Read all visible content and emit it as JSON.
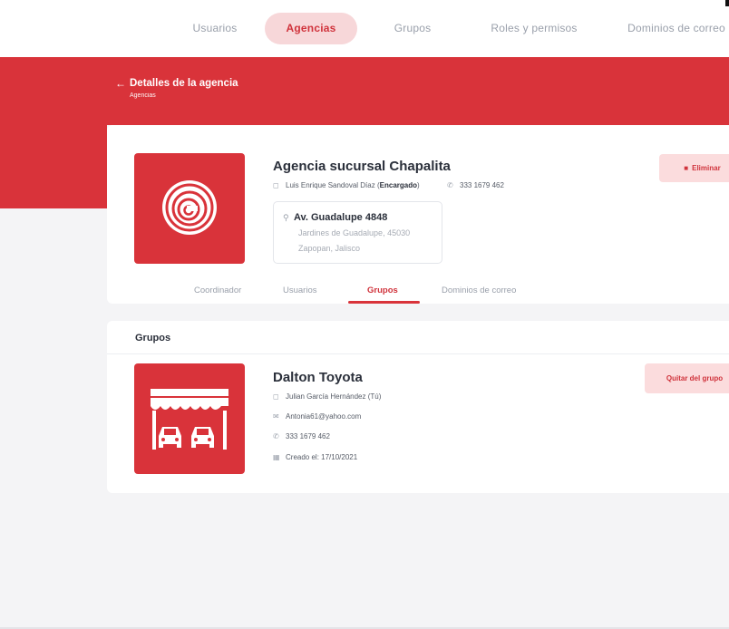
{
  "nav": {
    "tabs": [
      {
        "label": "Usuarios",
        "active": false
      },
      {
        "label": "Agencias",
        "active": true
      },
      {
        "label": "Grupos",
        "active": false
      },
      {
        "label": "Roles y permisos",
        "active": false
      },
      {
        "label": "Dominios de correo",
        "active": false
      }
    ]
  },
  "header": {
    "back_arrow": "←",
    "title": "Detalles de la agencia",
    "breadcrumb": "Agencias"
  },
  "agency": {
    "name": "Agencia sucursal Chapalita",
    "manager_name": "Luis Enrique Sandoval Díaz",
    "manager_paren_open": "(",
    "manager_role": "Encargado",
    "manager_paren_close": ")",
    "phone": "333 1679 462",
    "address": {
      "street": "Av. Guadalupe 4848",
      "line2": "Jardines de Guadalupe, 45030",
      "line3": "Zapopan, Jalisco"
    },
    "delete_label": "Eliminar"
  },
  "subtabs": [
    {
      "label": "Coordinador",
      "active": false
    },
    {
      "label": "Usuarios",
      "active": false
    },
    {
      "label": "Grupos",
      "active": true
    },
    {
      "label": "Dominios de correo",
      "active": false
    }
  ],
  "groups_section": {
    "title": "Grupos",
    "group": {
      "name": "Dalton Toyota",
      "owner": "Julian García Hernández (Tú)",
      "email": "Antonia61@yahoo.com",
      "phone": "333 1679 462",
      "created": "Creado el: 17/10/2021",
      "remove_label": "Quitar del grupo"
    }
  },
  "icons": {
    "user": "user-icon",
    "phone": "phone-icon",
    "pin": "map-pin-icon",
    "email": "envelope-icon",
    "calendar": "calendar-icon",
    "trash": "trash-icon",
    "back": "arrow-left-icon"
  },
  "colors": {
    "brand_red": "#d9333a",
    "active_tab_bg": "#f7d7d9",
    "button_light_bg": "#fbdcdd",
    "page_bg": "#f4f4f6"
  }
}
